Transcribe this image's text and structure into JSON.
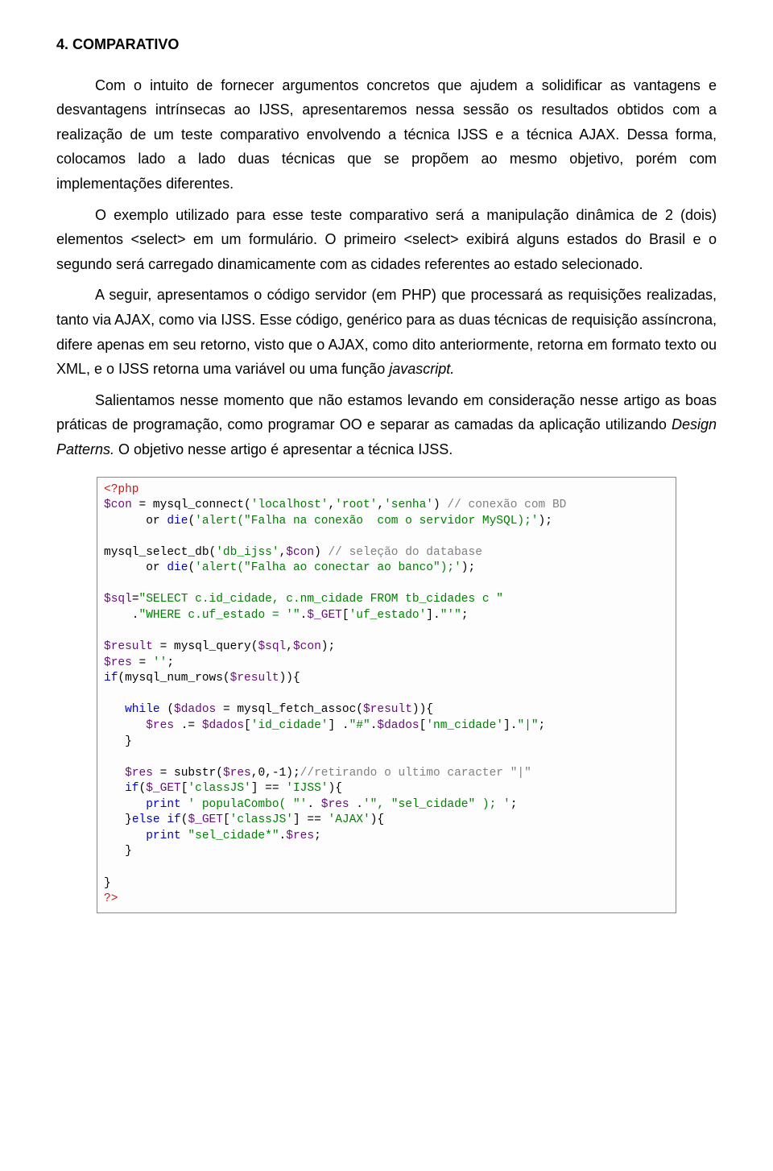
{
  "heading": "4. COMPARATIVO",
  "paragraphs": {
    "p1": "Com o intuito de fornecer argumentos concretos que ajudem a solidificar as vantagens e desvantagens intrínsecas ao IJSS, apresentaremos nessa sessão os resultados obtidos com a realização de um teste comparativo envolvendo a técnica IJSS e a técnica AJAX. Dessa forma, colocamos lado a lado duas técnicas que se propõem ao mesmo objetivo, porém com implementações diferentes.",
    "p2": "O exemplo utilizado para esse teste comparativo será a manipulação dinâmica de 2 (dois) elementos <select> em um formulário. O primeiro <select> exibirá alguns estados do Brasil e o segundo será carregado dinamicamente com as cidades referentes ao estado selecionado.",
    "p3": "A seguir, apresentamos o código servidor (em PHP) que processará as requisições realizadas, tanto via AJAX, como via IJSS. Esse código, genérico para as duas técnicas de requisição assíncrona, difere apenas em seu retorno, visto que o AJAX, como dito anteriormente, retorna em formato texto ou XML, e o IJSS retorna uma variável ou uma função ",
    "p3_italic": "javascript.",
    "p4a": "Salientamos nesse momento que não estamos levando em consideração nesse artigo as boas práticas de programação, como programar OO e separar as camadas da aplicação utilizando ",
    "p4_italic": "Design Patterns.",
    "p4b": " O objetivo nesse artigo é apresentar a técnica IJSS."
  },
  "code": {
    "l01a": "<?php",
    "l02a": "$con",
    "l02b": " = mysql_connect(",
    "l02c": "'localhost'",
    "l02d": ",",
    "l02e": "'root'",
    "l02f": ",",
    "l02g": "'senha'",
    "l02h": ") ",
    "l02i": "// conexão com BD",
    "l03a": "      or ",
    "l03b": "die",
    "l03c": "(",
    "l03d": "'alert(\"Falha na conexão  com o servidor MySQL);'",
    "l03e": ");",
    "l04": "",
    "l05a": "mysql_select_db(",
    "l05b": "'db_ijss'",
    "l05c": ",",
    "l05d": "$con",
    "l05e": ") ",
    "l05f": "// seleção do database",
    "l06a": "      or ",
    "l06b": "die",
    "l06c": "(",
    "l06d": "'alert(\"Falha ao conectar ao banco\");'",
    "l06e": ");",
    "l07": "",
    "l08a": "$sql",
    "l08b": "=",
    "l08c": "\"SELECT c.id_cidade, c.nm_cidade FROM tb_cidades c \"",
    "l09a": "    .",
    "l09b": "\"WHERE c.uf_estado = '\"",
    "l09c": ".",
    "l09d": "$_GET",
    "l09e": "[",
    "l09f": "'uf_estado'",
    "l09g": "].",
    "l09h": "\"'\"",
    "l09i": ";",
    "l10": "",
    "l11a": "$result",
    "l11b": " = mysql_query(",
    "l11c": "$sql",
    "l11d": ",",
    "l11e": "$con",
    "l11f": ");",
    "l12a": "$res",
    "l12b": " = ",
    "l12c": "''",
    "l12d": ";",
    "l13a": "if",
    "l13b": "(mysql_num_rows(",
    "l13c": "$result",
    "l13d": ")){",
    "l14": "",
    "l15a": "   while ",
    "l15b": "(",
    "l15c": "$dados",
    "l15d": " = mysql_fetch_assoc(",
    "l15e": "$result",
    "l15f": ")){",
    "l16a": "      $res",
    "l16b": " .= ",
    "l16c": "$dados",
    "l16d": "[",
    "l16e": "'id_cidade'",
    "l16f": "] .",
    "l16g": "\"#\"",
    "l16h": ".",
    "l16i": "$dados",
    "l16j": "[",
    "l16k": "'nm_cidade'",
    "l16l": "].",
    "l16m": "\"|\"",
    "l16n": ";",
    "l17": "   }",
    "l18": "",
    "l19a": "   $res",
    "l19b": " = substr(",
    "l19c": "$res",
    "l19d": ",",
    "l19e": "0",
    "l19f": ",-",
    "l19g": "1",
    "l19h": ");",
    "l19i": "//retirando o ultimo caracter \"|\"",
    "l20a": "   if",
    "l20b": "(",
    "l20c": "$_GET",
    "l20d": "[",
    "l20e": "'classJS'",
    "l20f": "] == ",
    "l20g": "'IJSS'",
    "l20h": "){",
    "l21a": "      print ",
    "l21b": "' populaCombo( \"'",
    "l21c": ". ",
    "l21d": "$res",
    "l21e": " .",
    "l21f": "'\", \"sel_cidade\" ); '",
    "l21g": ";",
    "l22a": "   }",
    "l22b": "else if",
    "l22c": "(",
    "l22d": "$_GET",
    "l22e": "[",
    "l22f": "'classJS'",
    "l22g": "] == ",
    "l22h": "'AJAX'",
    "l22i": "){",
    "l23a": "      print ",
    "l23b": "\"sel_cidade*\"",
    "l23c": ".",
    "l23d": "$res",
    "l23e": ";",
    "l24": "   }",
    "l25": "",
    "l26": "}",
    "l27a": "?>"
  }
}
